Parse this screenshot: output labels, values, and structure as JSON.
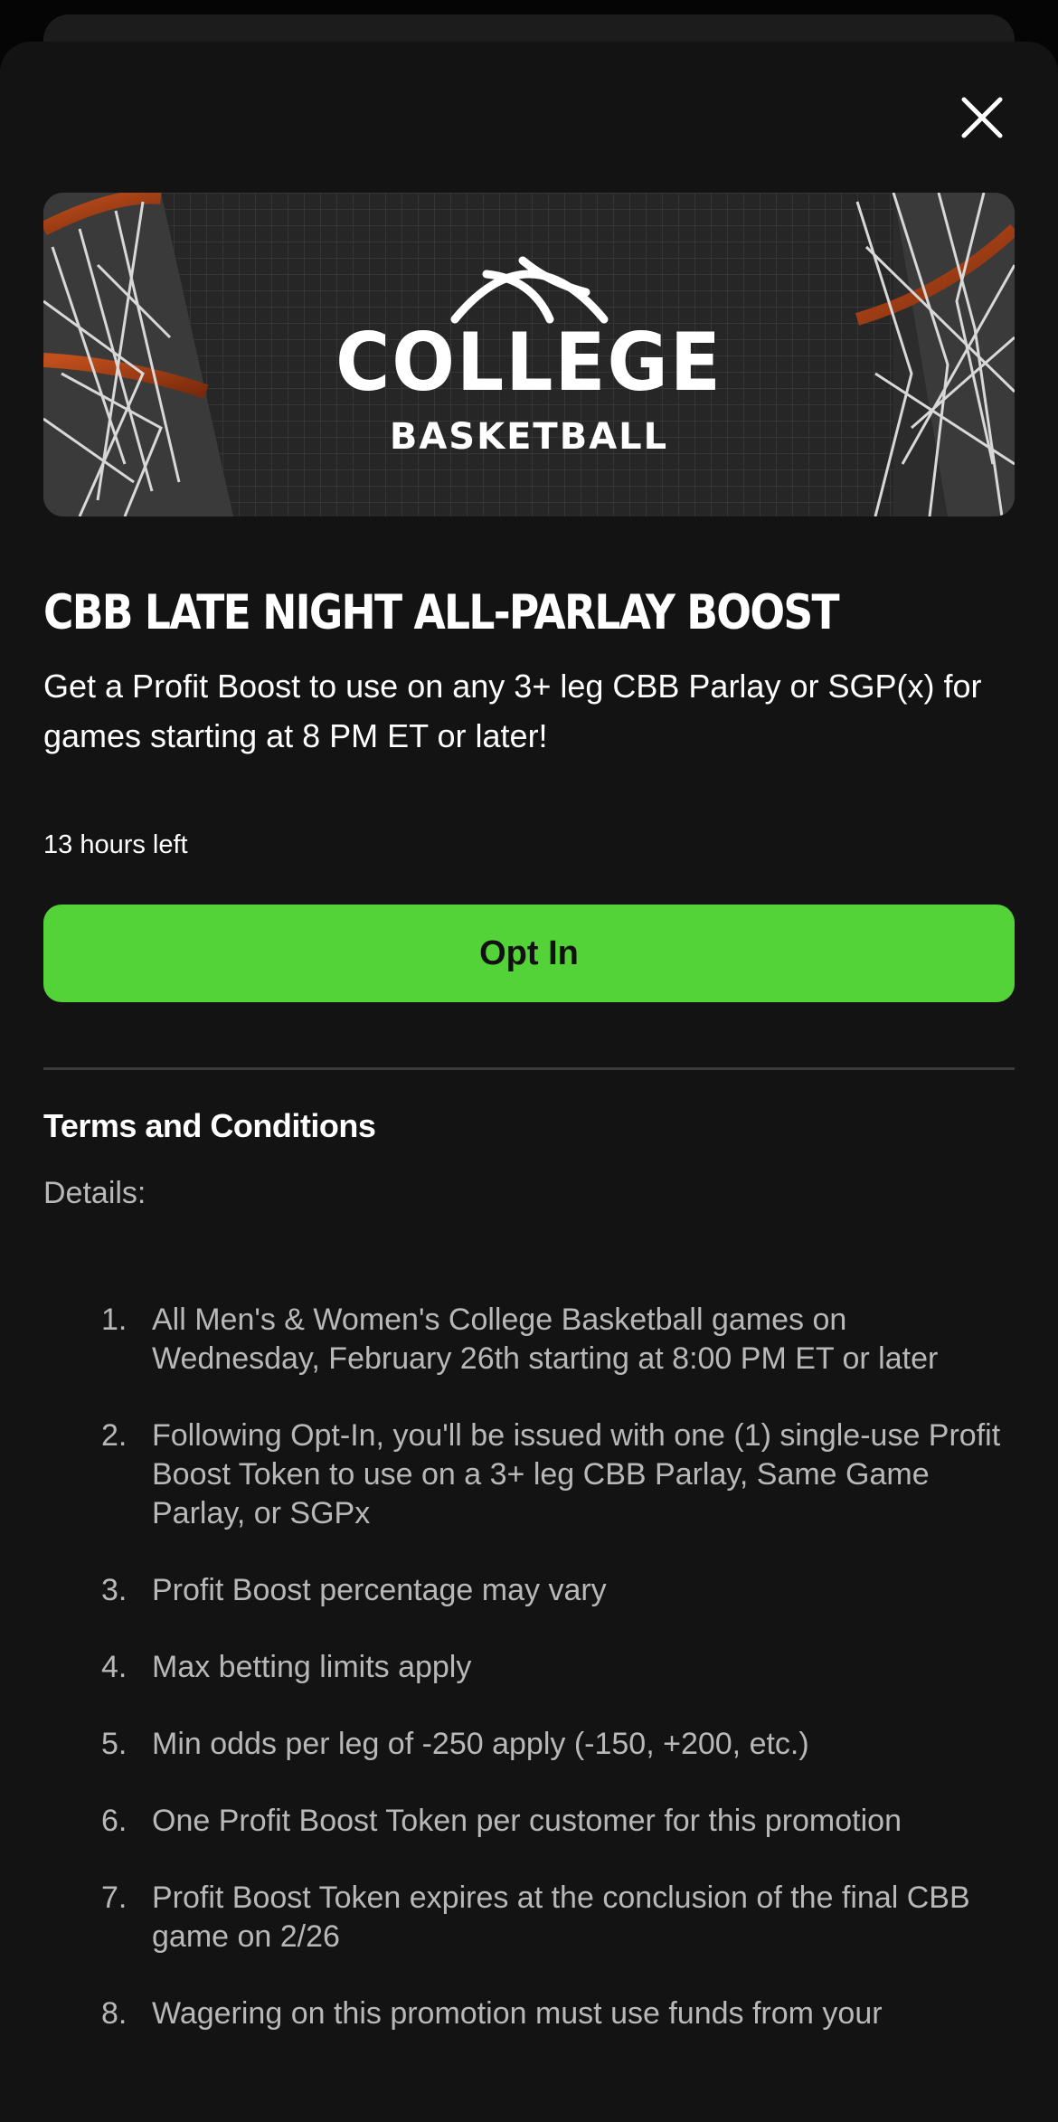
{
  "banner": {
    "title": "COLLEGE",
    "subtitle": "BASKETBALL"
  },
  "promo": {
    "title": "CBB LATE NIGHT ALL-PARLAY BOOST",
    "description": "Get a Profit Boost to use on any 3+ leg CBB Parlay or SGP(x) for games starting at 8 PM ET or later!",
    "time_left": "13 hours left",
    "opt_in_label": "Opt In"
  },
  "terms": {
    "heading": "Terms and Conditions",
    "details_label": "Details:",
    "items": [
      {
        "num": "1.",
        "text": "All Men's & Women's College Basketball games on Wednesday, February 26th starting at 8:00 PM ET or later"
      },
      {
        "num": "2.",
        "text": "Following Opt-In, you'll be issued with one (1) single-use Profit Boost Token to use on a 3+ leg CBB Parlay, Same Game Parlay, or SGPx"
      },
      {
        "num": "3.",
        "text": "Profit Boost percentage may vary"
      },
      {
        "num": "4.",
        "text": "Max betting limits apply"
      },
      {
        "num": "5.",
        "text": "Min odds per leg of -250 apply (-150, +200, etc.)"
      },
      {
        "num": "6.",
        "text": "One Profit Boost Token per customer for this promotion"
      },
      {
        "num": "7.",
        "text": "Profit Boost Token expires at the conclusion of the final CBB game on 2/26"
      },
      {
        "num": "8.",
        "text": "Wagering on this promotion must use funds from your"
      }
    ]
  },
  "colors": {
    "background": "#131313",
    "accent_green": "#53d337",
    "text_primary": "#ffffff",
    "text_secondary": "#b8b8b8"
  },
  "icons": {
    "close": "close-icon",
    "basketball": "basketball-icon"
  }
}
